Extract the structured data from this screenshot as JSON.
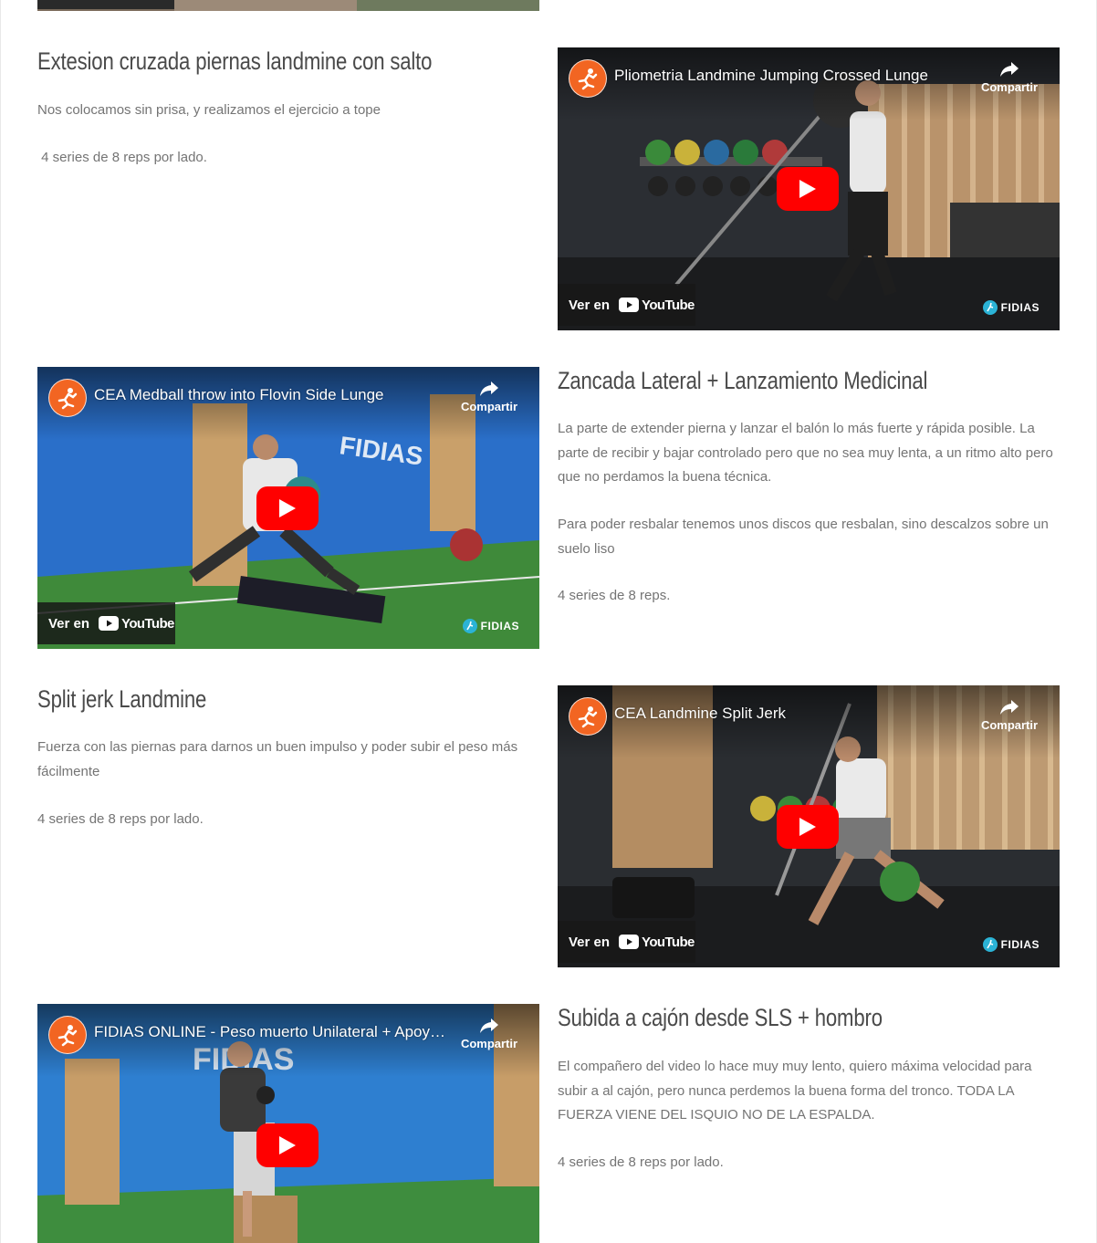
{
  "videos": [
    {
      "title": "Pliometria Landmine Jumping Crossed Lunge",
      "share_label": "Compartir",
      "watch_label": "Ver en",
      "youtube_word": "YouTube",
      "brand_watermark": "FIDIAS"
    },
    {
      "title": "CEA Medball throw into Flovin Side Lunge",
      "share_label": "Compartir",
      "watch_label": "Ver en",
      "youtube_word": "YouTube",
      "brand_watermark": "FIDIAS"
    },
    {
      "title": "CEA Landmine Split Jerk",
      "share_label": "Compartir",
      "watch_label": "Ver en",
      "youtube_word": "YouTube",
      "brand_watermark": "FIDIAS"
    },
    {
      "title": "FIDIAS ONLINE - Peso muerto Unilateral + Apoy…",
      "share_label": "Compartir"
    }
  ],
  "exercises": [
    {
      "title": "Extesion cruzada piernas landmine con salto",
      "paragraphs": [
        "Nos colocamos sin prisa, y realizamos el ejercicio a tope",
        " 4 series de 8 reps por lado."
      ]
    },
    {
      "title": "Zancada Lateral + Lanzamiento Medicinal",
      "paragraphs": [
        "La parte de extender pierna y lanzar el balón lo más fuerte y rápida posible. La parte de recibir y bajar controlado pero que no sea muy lenta, a un ritmo alto pero que no perdamos la buena técnica.",
        "Para poder resbalar tenemos unos discos que resbalan, sino descalzos sobre un suelo liso",
        "4 series de 8 reps."
      ]
    },
    {
      "title": "Split jerk Landmine",
      "paragraphs": [
        "Fuerza con las piernas para darnos un buen impulso y poder subir el peso más fácilmente",
        "4 series de 8 reps por lado."
      ]
    },
    {
      "title": "Subida a cajón desde SLS + hombro",
      "paragraphs": [
        "El compañero del video lo hace muy muy lento, quiero máxima velocidad para subir a al cajón, pero nunca perdemos la buena forma del tronco. TODA LA FUERZA VIENE DEL ISQUIO NO DE LA ESPALDA.",
        "4 series de 8 reps por lado."
      ]
    }
  ],
  "colors": {
    "accent_orange": "#f26522",
    "youtube_red": "#ff0000",
    "heading": "#4a4a4a",
    "body_text": "#747474"
  }
}
